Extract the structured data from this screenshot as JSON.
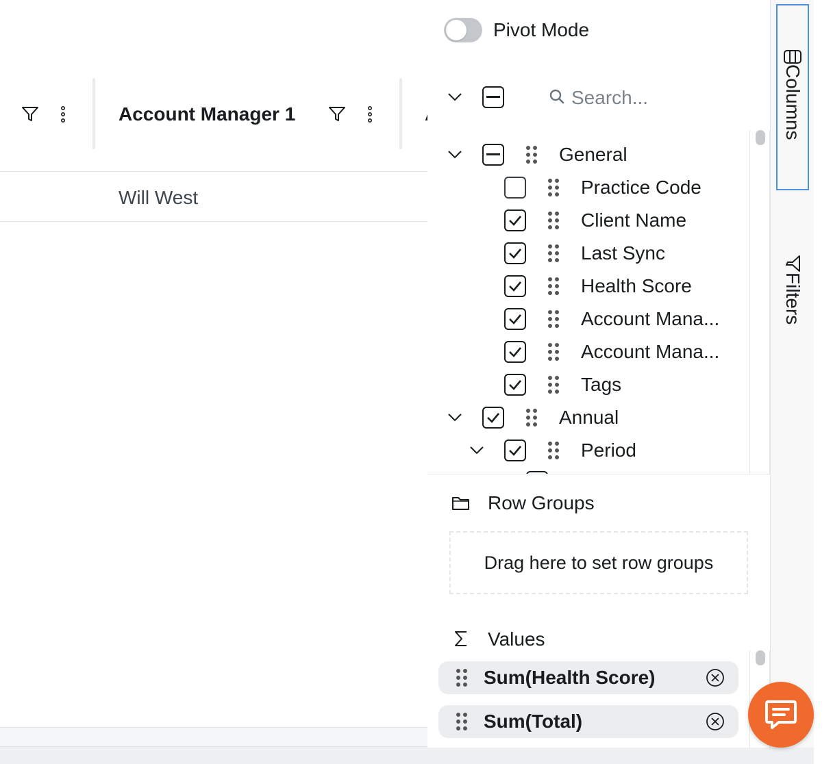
{
  "grid": {
    "header": {
      "column_title": "Account Manager 1",
      "next_title_fragment": "A"
    },
    "rows": [
      {
        "account_manager_1": "Will West"
      }
    ]
  },
  "tool_panel": {
    "pivot_mode": {
      "label": "Pivot Mode",
      "enabled": false
    },
    "search": {
      "placeholder": "Search..."
    },
    "column_tree": [
      {
        "label": "General",
        "level": 0,
        "expandable": true,
        "state": "indeterminate"
      },
      {
        "label": "Practice Code",
        "level": 1,
        "state": "unchecked"
      },
      {
        "label": "Client Name",
        "level": 1,
        "state": "checked"
      },
      {
        "label": "Last Sync",
        "level": 1,
        "state": "checked"
      },
      {
        "label": "Health Score",
        "level": 1,
        "state": "checked"
      },
      {
        "label": "Account Mana...",
        "level": 1,
        "state": "checked"
      },
      {
        "label": "Account Mana...",
        "level": 1,
        "state": "checked"
      },
      {
        "label": "Tags",
        "level": 1,
        "state": "checked"
      },
      {
        "label": "Annual",
        "level": 0,
        "expandable": true,
        "state": "checked"
      },
      {
        "label": "Period",
        "level": 1,
        "expandable": true,
        "state": "checked"
      }
    ],
    "row_groups": {
      "title": "Row Groups",
      "drop_hint": "Drag here to set row groups"
    },
    "values": {
      "title": "Values",
      "items": [
        {
          "label": "Sum(Health Score)"
        },
        {
          "label": "Sum(Total)"
        }
      ]
    }
  },
  "side_bar": {
    "tabs": [
      {
        "label": "Columns",
        "active": true
      },
      {
        "label": "Filters",
        "active": false
      }
    ]
  },
  "colors": {
    "accent": "#4a90e2",
    "chat_button": "#ef6a2c"
  }
}
